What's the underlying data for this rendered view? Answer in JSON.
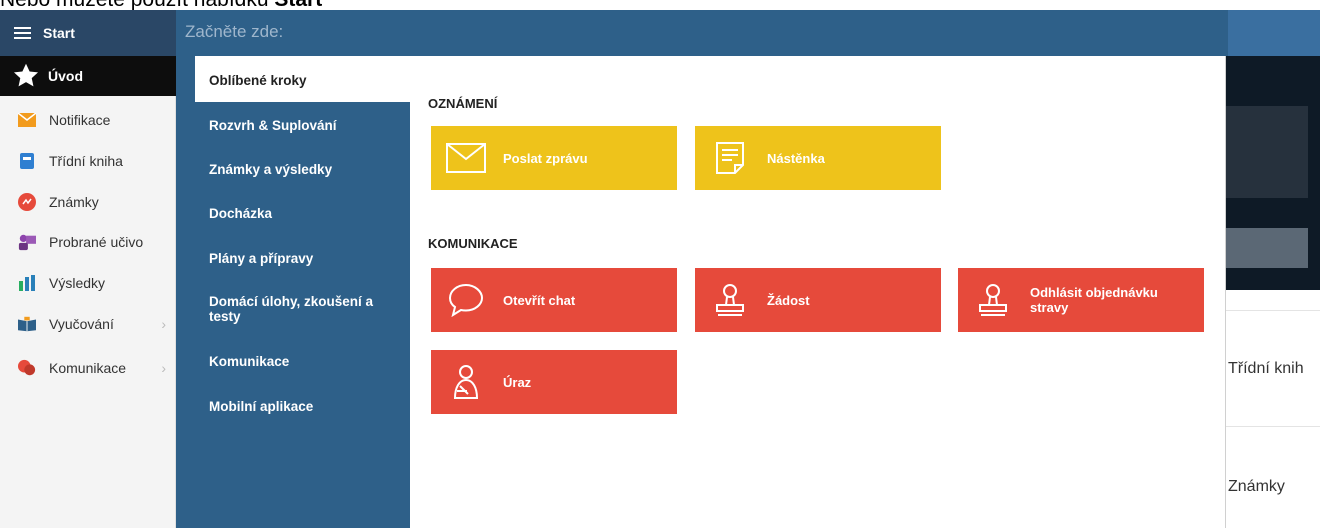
{
  "caption": {
    "prefix": "Nebo můžete použít nabídku ",
    "bold": "Start"
  },
  "topbar": {
    "start_label": "Start",
    "begin_here": "Začněte zde:"
  },
  "sidebar": {
    "items": [
      {
        "label": "Úvod",
        "icon": "star-icon"
      },
      {
        "label": "Notifikace",
        "icon": "envelope-icon"
      },
      {
        "label": "Třídní kniha",
        "icon": "book-icon"
      },
      {
        "label": "Známky",
        "icon": "grades-icon"
      },
      {
        "label": "Probrané učivo",
        "icon": "teacher-icon"
      },
      {
        "label": "Výsledky",
        "icon": "bar-chart-icon"
      },
      {
        "label": "Vyučování",
        "icon": "open-book-icon"
      },
      {
        "label": "Komunikace",
        "icon": "chat-icon"
      }
    ]
  },
  "menu": {
    "items": [
      "Oblíbené kroky",
      "Rozvrh & Suplování",
      "Známky a výsledky",
      "Docházka",
      "Plány a přípravy",
      "Domácí úlohy, zkoušení a testy",
      "Komunikace",
      "Mobilní aplikace"
    ]
  },
  "sections": {
    "announcements": {
      "title": "OZNÁMENÍ",
      "tiles": [
        {
          "label": "Poslat zprávu",
          "icon": "envelope-icon"
        },
        {
          "label": "Nástěnka",
          "icon": "notice-board-icon"
        }
      ]
    },
    "communication": {
      "title": "KOMUNIKACE",
      "tiles": [
        {
          "label": "Otevřít chat",
          "icon": "chat-bubble-icon"
        },
        {
          "label": "Žádost",
          "icon": "stamp-icon"
        },
        {
          "label": "Odhlásit objednávku stravy",
          "icon": "stamp-icon"
        },
        {
          "label": "Úraz",
          "icon": "injury-icon"
        }
      ]
    }
  },
  "background": {
    "items": [
      "Třídní knih",
      "Známky"
    ]
  },
  "colors": {
    "topbar": "#2e6089",
    "menu": "#2e6089",
    "yellow_tile": "#eec31b",
    "red_tile": "#e64a3b"
  }
}
